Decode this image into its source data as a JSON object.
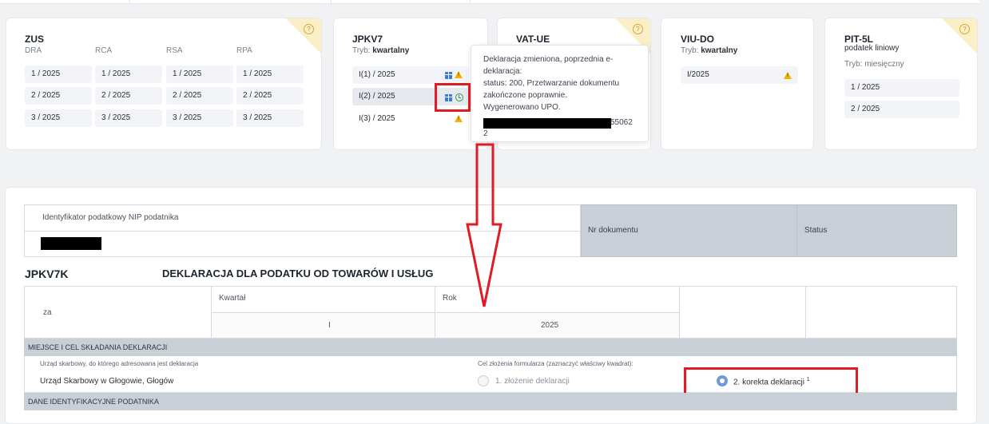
{
  "cards": {
    "zus": {
      "title": "ZUS",
      "columns": [
        "DRA",
        "RCA",
        "RSA",
        "RPA"
      ],
      "rows": [
        [
          "1 / 2025",
          "1 / 2025",
          "1 / 2025",
          "1 / 2025"
        ],
        [
          "2 / 2025",
          "2 / 2025",
          "2 / 2025",
          "2 / 2025"
        ],
        [
          "3 / 2025",
          "3 / 2025",
          "3 / 2025",
          "3 / 2025"
        ]
      ]
    },
    "jpkv7": {
      "title": "JPKV7",
      "mode_label": "Tryb:",
      "mode_value": "kwartalny",
      "items": [
        "I(1) / 2025",
        "I(2) / 2025",
        "I(3) / 2025"
      ]
    },
    "vatue": {
      "title": "VAT-UE"
    },
    "viudo": {
      "title": "VIU-DO",
      "mode_label": "Tryb:",
      "mode_value": "kwartalny",
      "items": [
        "I/2025"
      ]
    },
    "pit5l": {
      "title": "PIT-5L",
      "subtitle": "podatek liniowy",
      "mode_label": "Tryb:",
      "mode_value": "miesięczny",
      "items": [
        "1 / 2025",
        "2 / 2025"
      ]
    }
  },
  "tooltip": {
    "lines": [
      "Deklaracja zmieniona, poprzednia e-",
      "deklaracja:",
      "status: 200, Przetwarzanie dokumentu",
      "zakończone poprawnie.",
      "Wygenerowano UPO."
    ],
    "id_tail": "55062",
    "id_end": "2"
  },
  "form": {
    "nip_label": "Identyfikator podatkowy NIP podatnika",
    "doc_number_label": "Nr dokumentu",
    "status_label": "Status",
    "form_code": "JPKV7K",
    "form_title": "DEKLARACJA DLA PODATKU OD TOWARÓW I USŁUG",
    "period_label": "za",
    "quarter_label": "Kwartał",
    "quarter_value": "I",
    "year_label": "Rok",
    "year_value": "2025",
    "section1": "MIEJSCE I CEL SKŁADANIA DEKLARACJI",
    "office_label": "Urząd skarbowy, do którego adresowana jest deklaracja",
    "office_value": "Urząd Skarbowy w Głogowie, Głogów",
    "purpose_label": "Cel złożenia formularza (zaznaczyć właściwy kwadrat):",
    "option1": "1. złożenie deklaracji",
    "option2": "2. korekta deklaracji",
    "option2_sup": "1",
    "section2": "DANE IDENTYFIKACYJNE PODATNIKA"
  },
  "colors": {
    "highlight_red": "#e01b23",
    "warning": "#f2b300",
    "info_blue": "#3a7bd5",
    "success_green": "#2e9a52"
  }
}
